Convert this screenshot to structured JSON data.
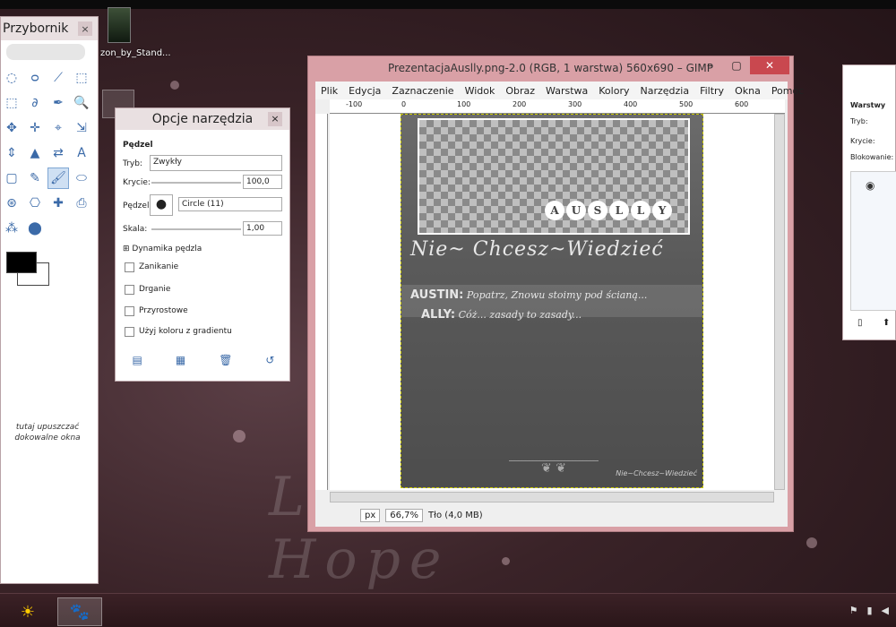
{
  "desktop": {
    "icon_label": "zon_by_Stand...",
    "watermark": "Love Wuwse Hope"
  },
  "toolbox": {
    "title": "Przybornik",
    "close": "×",
    "drop_hint": "tutaj upuszczać dokowalne okna",
    "tools": [
      "◌",
      "ᴑ",
      "⟋",
      "⬚",
      "⬚",
      "∂",
      "✒",
      "🔍",
      "✥",
      "✛",
      "⌖",
      "⇲",
      "⇕",
      "▲",
      "⇄",
      "A",
      "▢",
      "✎",
      "🖌",
      "⬭",
      "⊛",
      "⎔",
      "✚",
      "⎙",
      "⁂",
      "⬤"
    ]
  },
  "options": {
    "title": "Opcje narzędzia",
    "close": "×",
    "section": "Pędzel",
    "mode_label": "Tryb:",
    "mode_value": "Zwykły",
    "opacity_label": "Krycie:",
    "opacity_value": "100,0",
    "brush_label": "Pędzel:",
    "brush_value": "Circle (11)",
    "scale_label": "Skala:",
    "scale_value": "1,00",
    "dynamics": "Dynamika pędzla",
    "checks": [
      "Zanikanie",
      "Drganie",
      "Przyrostowe",
      "Użyj koloru z gradientu"
    ]
  },
  "gimp": {
    "title": "PrezentacjaAuslly.png-2.0 (RGB, 1 warstwa) 560x690 – GIMP",
    "menu": [
      "Plik",
      "Edycja",
      "Zaznaczenie",
      "Widok",
      "Obraz",
      "Warstwa",
      "Kolory",
      "Narzędzia",
      "Filtry",
      "Okna",
      "Pomoc"
    ],
    "ruler": [
      "-100",
      "0",
      "100",
      "200",
      "300",
      "400",
      "500",
      "600"
    ],
    "image": {
      "banner": [
        "A",
        "U",
        "S",
        "L",
        "L",
        "Y"
      ],
      "title": "Nie~ Chcesz~Wiedzieć",
      "line1_name": "AUSTIN:",
      "line1_text": " Popatrz, Znowu stoimy pod ścianą...",
      "line2_name": "ALLY:",
      "line2_text": " Cóż... zasady to zasady...",
      "signature": "Nie~Chcesz~Wiedzieć"
    },
    "status": {
      "unit": "px",
      "zoom": "66,7%",
      "info": "Tło (4,0 MB)"
    }
  },
  "layers": {
    "title": "Warstwy",
    "mode_label": "Tryb:",
    "opacity_label": "Krycie:",
    "lock_label": "Blokowanie:"
  }
}
